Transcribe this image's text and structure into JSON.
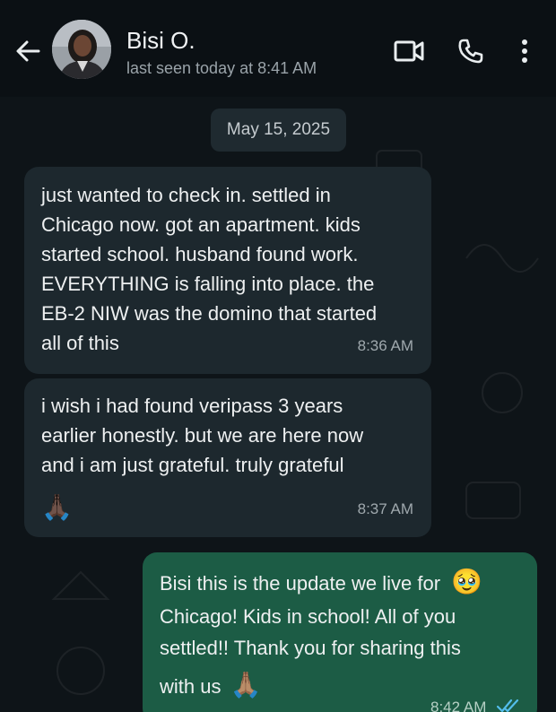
{
  "header": {
    "contact_name": "Bisi O.",
    "last_seen": "last seen today at 8:41 AM",
    "icons": [
      "back-arrow-icon",
      "video-call-icon",
      "phone-icon",
      "more-options-icon"
    ]
  },
  "chat": {
    "date_chip": "May 15, 2025",
    "messages": [
      {
        "direction": "incoming",
        "lines": [
          "just wanted to check in. settled in",
          "Chicago now. got an apartment. kids",
          "started school. husband found work.",
          "EVERYTHING is falling into place. the",
          "EB-2 NIW was the domino that started",
          "all of this"
        ],
        "time": "8:36 AM"
      },
      {
        "direction": "incoming",
        "lines": [
          "i wish i had found veripass 3 years",
          "earlier honestly. but we are here now",
          "and i am just grateful. truly grateful"
        ],
        "emoji": "🙏🏿",
        "time": "8:37 AM"
      },
      {
        "direction": "outgoing",
        "lines": [
          "Bisi this is the update we live for",
          "Chicago! Kids in school! All of you",
          "settled!! Thank you for sharing this",
          "with us"
        ],
        "line1_emoji": "🥹",
        "line4_emoji": "🙏🏽",
        "time": "8:42 AM",
        "read_receipt": "double-check-read-icon"
      }
    ]
  },
  "colors": {
    "background": "#0b1014",
    "incoming_bubble": "#1d282e",
    "outgoing_bubble": "#1c5c45",
    "read_tick": "#53bdeb"
  }
}
